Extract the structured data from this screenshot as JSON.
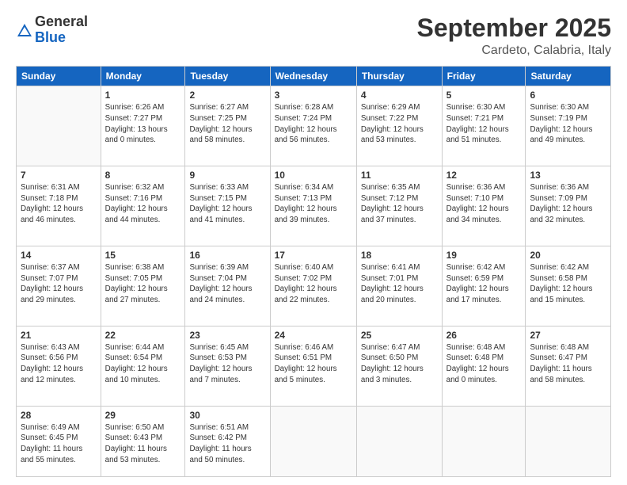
{
  "logo": {
    "general": "General",
    "blue": "Blue"
  },
  "header": {
    "month": "September 2025",
    "location": "Cardeto, Calabria, Italy"
  },
  "weekdays": [
    "Sunday",
    "Monday",
    "Tuesday",
    "Wednesday",
    "Thursday",
    "Friday",
    "Saturday"
  ],
  "weeks": [
    [
      {
        "day": "",
        "info": ""
      },
      {
        "day": "1",
        "info": "Sunrise: 6:26 AM\nSunset: 7:27 PM\nDaylight: 13 hours\nand 0 minutes."
      },
      {
        "day": "2",
        "info": "Sunrise: 6:27 AM\nSunset: 7:25 PM\nDaylight: 12 hours\nand 58 minutes."
      },
      {
        "day": "3",
        "info": "Sunrise: 6:28 AM\nSunset: 7:24 PM\nDaylight: 12 hours\nand 56 minutes."
      },
      {
        "day": "4",
        "info": "Sunrise: 6:29 AM\nSunset: 7:22 PM\nDaylight: 12 hours\nand 53 minutes."
      },
      {
        "day": "5",
        "info": "Sunrise: 6:30 AM\nSunset: 7:21 PM\nDaylight: 12 hours\nand 51 minutes."
      },
      {
        "day": "6",
        "info": "Sunrise: 6:30 AM\nSunset: 7:19 PM\nDaylight: 12 hours\nand 49 minutes."
      }
    ],
    [
      {
        "day": "7",
        "info": "Sunrise: 6:31 AM\nSunset: 7:18 PM\nDaylight: 12 hours\nand 46 minutes."
      },
      {
        "day": "8",
        "info": "Sunrise: 6:32 AM\nSunset: 7:16 PM\nDaylight: 12 hours\nand 44 minutes."
      },
      {
        "day": "9",
        "info": "Sunrise: 6:33 AM\nSunset: 7:15 PM\nDaylight: 12 hours\nand 41 minutes."
      },
      {
        "day": "10",
        "info": "Sunrise: 6:34 AM\nSunset: 7:13 PM\nDaylight: 12 hours\nand 39 minutes."
      },
      {
        "day": "11",
        "info": "Sunrise: 6:35 AM\nSunset: 7:12 PM\nDaylight: 12 hours\nand 37 minutes."
      },
      {
        "day": "12",
        "info": "Sunrise: 6:36 AM\nSunset: 7:10 PM\nDaylight: 12 hours\nand 34 minutes."
      },
      {
        "day": "13",
        "info": "Sunrise: 6:36 AM\nSunset: 7:09 PM\nDaylight: 12 hours\nand 32 minutes."
      }
    ],
    [
      {
        "day": "14",
        "info": "Sunrise: 6:37 AM\nSunset: 7:07 PM\nDaylight: 12 hours\nand 29 minutes."
      },
      {
        "day": "15",
        "info": "Sunrise: 6:38 AM\nSunset: 7:05 PM\nDaylight: 12 hours\nand 27 minutes."
      },
      {
        "day": "16",
        "info": "Sunrise: 6:39 AM\nSunset: 7:04 PM\nDaylight: 12 hours\nand 24 minutes."
      },
      {
        "day": "17",
        "info": "Sunrise: 6:40 AM\nSunset: 7:02 PM\nDaylight: 12 hours\nand 22 minutes."
      },
      {
        "day": "18",
        "info": "Sunrise: 6:41 AM\nSunset: 7:01 PM\nDaylight: 12 hours\nand 20 minutes."
      },
      {
        "day": "19",
        "info": "Sunrise: 6:42 AM\nSunset: 6:59 PM\nDaylight: 12 hours\nand 17 minutes."
      },
      {
        "day": "20",
        "info": "Sunrise: 6:42 AM\nSunset: 6:58 PM\nDaylight: 12 hours\nand 15 minutes."
      }
    ],
    [
      {
        "day": "21",
        "info": "Sunrise: 6:43 AM\nSunset: 6:56 PM\nDaylight: 12 hours\nand 12 minutes."
      },
      {
        "day": "22",
        "info": "Sunrise: 6:44 AM\nSunset: 6:54 PM\nDaylight: 12 hours\nand 10 minutes."
      },
      {
        "day": "23",
        "info": "Sunrise: 6:45 AM\nSunset: 6:53 PM\nDaylight: 12 hours\nand 7 minutes."
      },
      {
        "day": "24",
        "info": "Sunrise: 6:46 AM\nSunset: 6:51 PM\nDaylight: 12 hours\nand 5 minutes."
      },
      {
        "day": "25",
        "info": "Sunrise: 6:47 AM\nSunset: 6:50 PM\nDaylight: 12 hours\nand 3 minutes."
      },
      {
        "day": "26",
        "info": "Sunrise: 6:48 AM\nSunset: 6:48 PM\nDaylight: 12 hours\nand 0 minutes."
      },
      {
        "day": "27",
        "info": "Sunrise: 6:48 AM\nSunset: 6:47 PM\nDaylight: 11 hours\nand 58 minutes."
      }
    ],
    [
      {
        "day": "28",
        "info": "Sunrise: 6:49 AM\nSunset: 6:45 PM\nDaylight: 11 hours\nand 55 minutes."
      },
      {
        "day": "29",
        "info": "Sunrise: 6:50 AM\nSunset: 6:43 PM\nDaylight: 11 hours\nand 53 minutes."
      },
      {
        "day": "30",
        "info": "Sunrise: 6:51 AM\nSunset: 6:42 PM\nDaylight: 11 hours\nand 50 minutes."
      },
      {
        "day": "",
        "info": ""
      },
      {
        "day": "",
        "info": ""
      },
      {
        "day": "",
        "info": ""
      },
      {
        "day": "",
        "info": ""
      }
    ]
  ]
}
